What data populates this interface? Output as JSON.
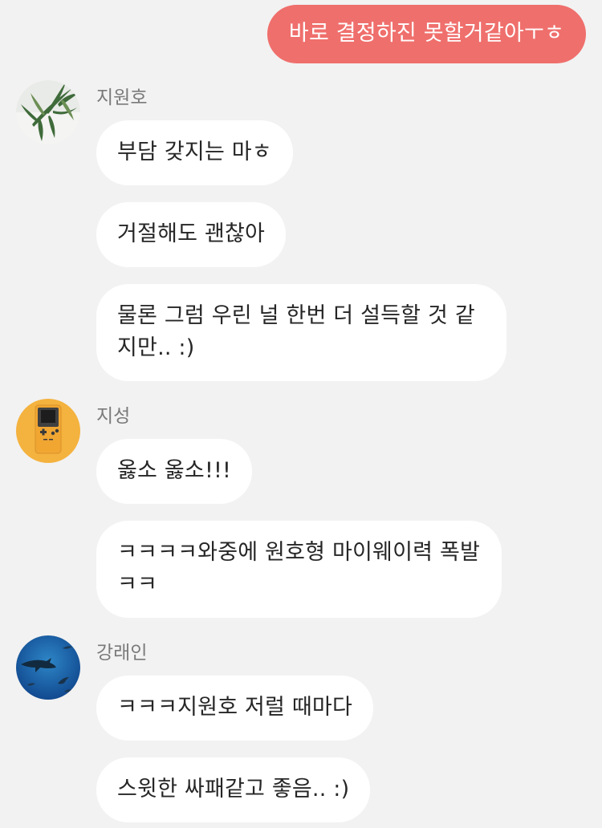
{
  "outgoing": {
    "message": "바로 결정하진 못할거같아ㅜㅎ",
    "color": "#ef6f6c"
  },
  "groups": [
    {
      "sender": "지원호",
      "avatar_icon": "leaf-plant-avatar",
      "messages": [
        "부담 갖지는 마ㅎ",
        "거절해도 괜찮아",
        "물론 그럼 우린 널 한번 더 설득할 것 같지만.. :)"
      ]
    },
    {
      "sender": "지성",
      "avatar_icon": "gameboy-avatar",
      "messages": [
        "옳소 옳소!!!",
        "ㅋㅋㅋㅋ와중에 원호형 마이웨이력 폭발ㅋㅋ"
      ]
    },
    {
      "sender": "강래인",
      "avatar_icon": "shark-ocean-avatar",
      "messages": [
        "ㅋㅋㅋ지원호 저럴 때마다",
        "스윗한 싸패같고 좋음.. :)"
      ]
    }
  ]
}
